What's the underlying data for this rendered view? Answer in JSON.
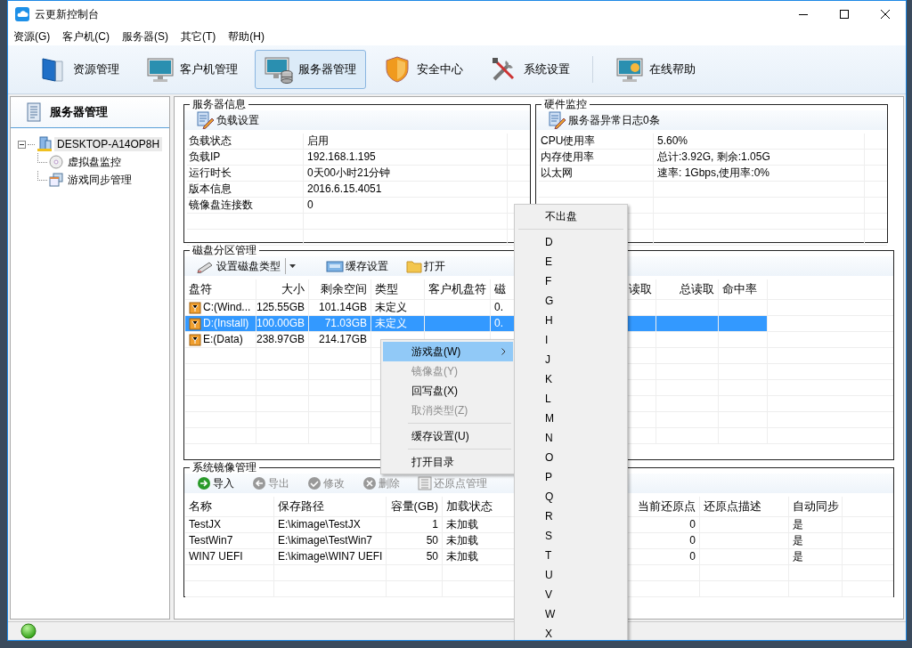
{
  "window": {
    "title": "云更新控制台"
  },
  "menu": [
    {
      "label": "资源(G)"
    },
    {
      "label": "客户机(C)"
    },
    {
      "label": "服务器(S)"
    },
    {
      "label": "其它(T)"
    },
    {
      "label": "帮助(H)"
    }
  ],
  "toolbar": [
    {
      "label": "资源管理",
      "selected": false
    },
    {
      "label": "客户机管理",
      "selected": false
    },
    {
      "label": "服务器管理",
      "selected": true
    },
    {
      "label": "安全中心",
      "selected": false
    },
    {
      "label": "系统设置",
      "selected": false
    },
    {
      "label": "在线帮助",
      "selected": false
    }
  ],
  "sidebar": {
    "title": "服务器管理",
    "tree": [
      {
        "label": "DESKTOP-A14OP8H",
        "expanded": true,
        "selected": true,
        "children": [
          {
            "label": "虚拟盘监控"
          },
          {
            "label": "游戏同步管理"
          }
        ]
      }
    ]
  },
  "server_info": {
    "title": "服务器信息",
    "action": "负载设置",
    "rows": [
      [
        "负载状态",
        "启用"
      ],
      [
        "负载IP",
        "192.168.1.195"
      ],
      [
        "运行时长",
        "0天00小时21分钟"
      ],
      [
        "版本信息",
        "2016.6.15.4051"
      ],
      [
        "镜像盘连接数",
        "0"
      ]
    ]
  },
  "hardware": {
    "title": "硬件监控",
    "action": "服务器异常日志0条",
    "rows": [
      [
        "CPU使用率",
        "5.60%"
      ],
      [
        "内存使用率",
        "总计:3.92G, 剩余:1.05G"
      ],
      [
        "以太网",
        "速率: 1Gbps,使用率:0%"
      ]
    ]
  },
  "disk": {
    "title": "磁盘分区管理",
    "actions": [
      {
        "label": "设置磁盘类型",
        "dropdown": true
      },
      {
        "label": "缓存设置",
        "dropdown": false
      },
      {
        "label": "打开",
        "dropdown": false
      }
    ],
    "columns": [
      "盘符",
      "大小",
      "剩余空间",
      "类型",
      "客户机盘符",
      "磁",
      "读取",
      "总读取",
      "命中率"
    ],
    "rows": [
      {
        "selected": false,
        "cells": [
          "C:(Wind...",
          "125.55GB",
          "101.14GB",
          "未定义",
          "",
          "0.",
          "",
          "",
          ""
        ]
      },
      {
        "selected": true,
        "cells": [
          "D:(Install)",
          "100.00GB",
          "71.03GB",
          "未定义",
          "",
          "0.",
          "",
          "",
          ""
        ]
      },
      {
        "selected": false,
        "cells": [
          "E:(Data)",
          "238.97GB",
          "214.17GB",
          "",
          "",
          "",
          "",
          "",
          ""
        ]
      }
    ]
  },
  "mirror": {
    "title": "系统镜像管理",
    "actions": [
      {
        "label": "导入",
        "disabled": false
      },
      {
        "label": "导出",
        "disabled": true
      },
      {
        "label": "修改",
        "disabled": true
      },
      {
        "label": "删除",
        "disabled": true
      },
      {
        "label": "还原点管理",
        "disabled": true
      }
    ],
    "columns": [
      "名称",
      "保存路径",
      "容量(GB)",
      "加载状态",
      "当前还原点",
      "还原点描述",
      "自动同步"
    ],
    "rows": [
      {
        "cells": [
          "TestJX",
          "E:\\kimage\\TestJX",
          "1",
          "未加载",
          "0",
          "",
          "是"
        ]
      },
      {
        "cells": [
          "TestWin7",
          "E:\\kimage\\TestWin7",
          "50",
          "未加载",
          "0",
          "",
          "是"
        ]
      },
      {
        "cells": [
          "WIN7 UEFI",
          "E:\\kimage\\WIN7 UEFI",
          "50",
          "未加载",
          "0",
          "",
          "是"
        ]
      }
    ]
  },
  "context_menu": {
    "items": [
      {
        "kind": "item",
        "label": "游戏盘(W)",
        "highlighted": true,
        "submenu": true,
        "disabled": false
      },
      {
        "kind": "item",
        "label": "镜像盘(Y)",
        "highlighted": false,
        "submenu": false,
        "disabled": true
      },
      {
        "kind": "item",
        "label": "回写盘(X)",
        "highlighted": false,
        "submenu": false,
        "disabled": false
      },
      {
        "kind": "item",
        "label": "取消类型(Z)",
        "highlighted": false,
        "submenu": false,
        "disabled": true
      },
      {
        "kind": "separator"
      },
      {
        "kind": "item",
        "label": "缓存设置(U)",
        "highlighted": false,
        "submenu": false,
        "disabled": false
      },
      {
        "kind": "separator"
      },
      {
        "kind": "item",
        "label": "打开目录",
        "highlighted": false,
        "submenu": false,
        "disabled": false
      }
    ]
  },
  "submenu": {
    "items": [
      {
        "kind": "item",
        "label": "不出盘"
      },
      {
        "kind": "separator"
      },
      {
        "kind": "item",
        "label": "D"
      },
      {
        "kind": "item",
        "label": "E"
      },
      {
        "kind": "item",
        "label": "F"
      },
      {
        "kind": "item",
        "label": "G"
      },
      {
        "kind": "item",
        "label": "H"
      },
      {
        "kind": "item",
        "label": "I"
      },
      {
        "kind": "item",
        "label": "J"
      },
      {
        "kind": "item",
        "label": "K"
      },
      {
        "kind": "item",
        "label": "L"
      },
      {
        "kind": "item",
        "label": "M"
      },
      {
        "kind": "item",
        "label": "N"
      },
      {
        "kind": "item",
        "label": "O"
      },
      {
        "kind": "item",
        "label": "P"
      },
      {
        "kind": "item",
        "label": "Q"
      },
      {
        "kind": "item",
        "label": "R"
      },
      {
        "kind": "item",
        "label": "S"
      },
      {
        "kind": "item",
        "label": "T"
      },
      {
        "kind": "item",
        "label": "U"
      },
      {
        "kind": "item",
        "label": "V"
      },
      {
        "kind": "item",
        "label": "W"
      },
      {
        "kind": "item",
        "label": "X"
      }
    ]
  }
}
